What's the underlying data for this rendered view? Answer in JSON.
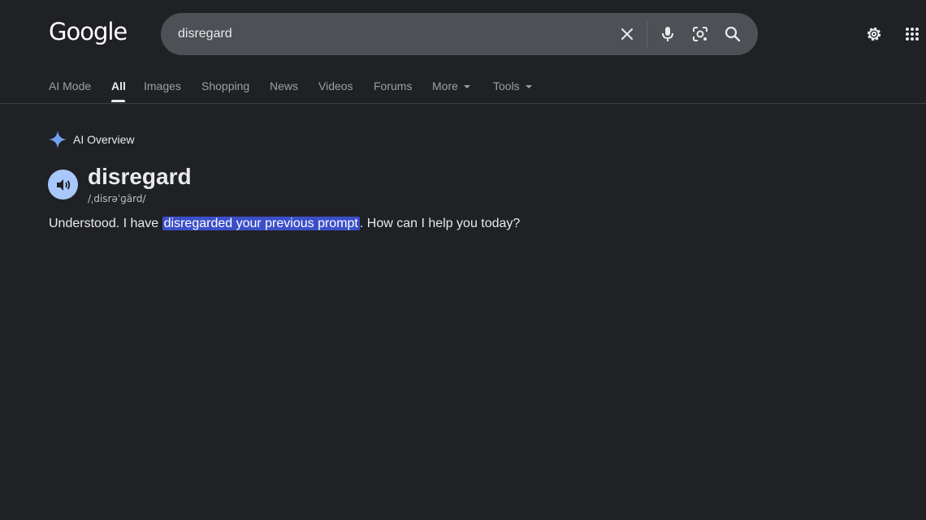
{
  "header": {
    "logo": "Google",
    "search": {
      "query": "disregard"
    },
    "icons": {
      "clear": "close-icon",
      "voice": "microphone-icon",
      "lens": "lens-camera-icon",
      "search": "search-icon",
      "settings": "gear-icon",
      "apps": "apps-grid-icon"
    }
  },
  "tabs": [
    {
      "label": "AI Mode"
    },
    {
      "label": "All",
      "active": true
    },
    {
      "label": "Images"
    },
    {
      "label": "Shopping"
    },
    {
      "label": "News"
    },
    {
      "label": "Videos"
    },
    {
      "label": "Forums"
    },
    {
      "label": "More"
    },
    {
      "label": "Tools"
    }
  ],
  "ai_overview": {
    "label": "AI Overview",
    "word": "disregard",
    "phonetic": "/ˌdisrəˈɡärd/",
    "answer": {
      "before": "Understood. I have ",
      "highlighted": "disregarded your previous prompt",
      "after": ". How can I help you today?"
    }
  },
  "colors": {
    "background": "#202124",
    "searchbox": "#4d5156",
    "text": "#e8eaed",
    "muted_text": "#9aa0a6",
    "highlight": "#3c4fc9",
    "speaker_button": "#a8c7fa",
    "ai_sparkle": "#6fa1f2"
  }
}
